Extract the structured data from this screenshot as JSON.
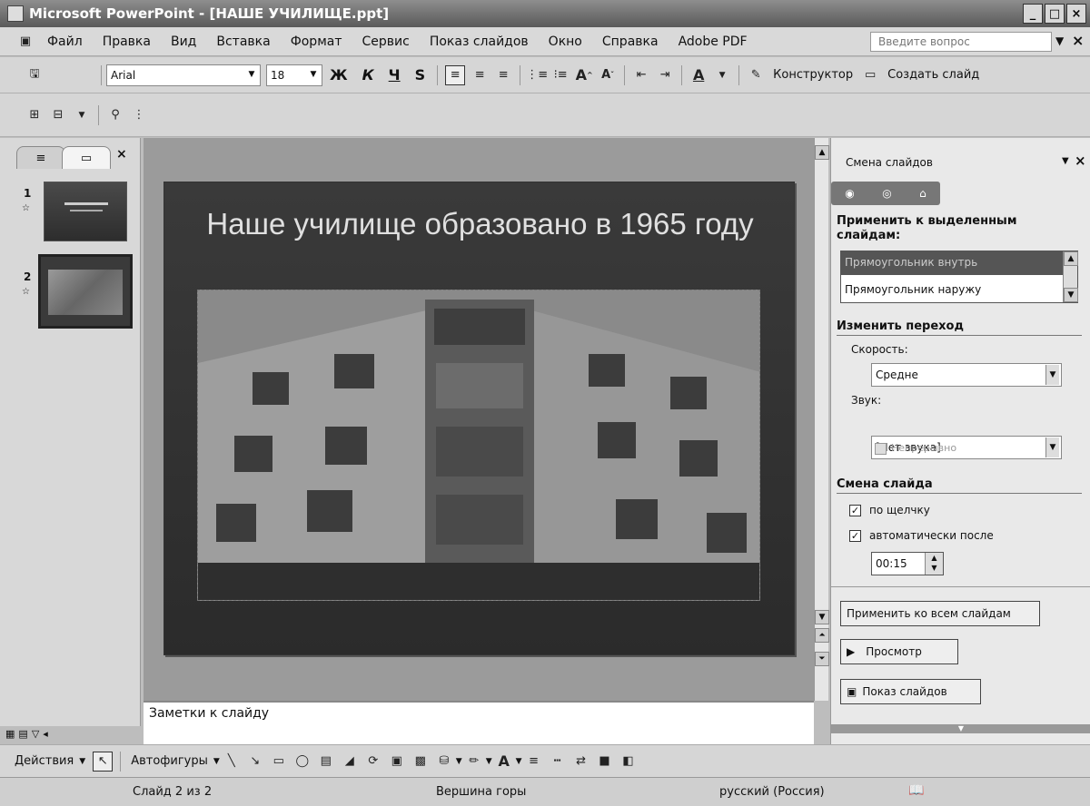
{
  "window": {
    "title": "Microsoft PowerPoint - [НАШЕ УЧИЛИЩЕ.ppt]"
  },
  "menu": {
    "items": [
      "Файл",
      "Правка",
      "Вид",
      "Вставка",
      "Формат",
      "Сервис",
      "Показ слайдов",
      "Окно",
      "Справка",
      "Adobe PDF"
    ],
    "question_placeholder": "Введите вопрос"
  },
  "format_toolbar": {
    "font": "Arial",
    "size": "18",
    "bold": "Ж",
    "italic": "К",
    "underline": "Ч",
    "shadow": "S",
    "designer": "Конструктор",
    "new_slide": "Создать слайд"
  },
  "slides_panel": {
    "thumbnails": [
      {
        "number": "1"
      },
      {
        "number": "2"
      }
    ]
  },
  "slide": {
    "title": "Наше училище образовано в 1965 году"
  },
  "notes": {
    "placeholder": "Заметки к слайду"
  },
  "task_pane": {
    "title": "Смена слайдов",
    "apply_heading": "Применить к выделенным слайдам:",
    "transitions": [
      "Прямоугольник внутрь",
      "Прямоугольник наружу"
    ],
    "selected_transition": "Прямоугольник внутрь",
    "change_heading": "Изменить переход",
    "speed_label": "Скорость:",
    "speed_value": "Средне",
    "sound_label": "Звук:",
    "sound_value": "[Нет звука]",
    "loop_label": "Непрерывно",
    "advance_heading": "Смена слайда",
    "on_click_label": "по щелчку",
    "on_click_checked": true,
    "auto_label": "автоматически после",
    "auto_checked": true,
    "auto_time": "00:15",
    "apply_all": "Применить ко всем слайдам",
    "preview": "Просмотр",
    "slideshow": "Показ слайдов"
  },
  "draw_toolbar": {
    "actions": "Действия",
    "autoshapes": "Автофигуры"
  },
  "status": {
    "slide": "Слайд 2 из 2",
    "design": "Вершина горы",
    "language": "русский (Россия)"
  }
}
